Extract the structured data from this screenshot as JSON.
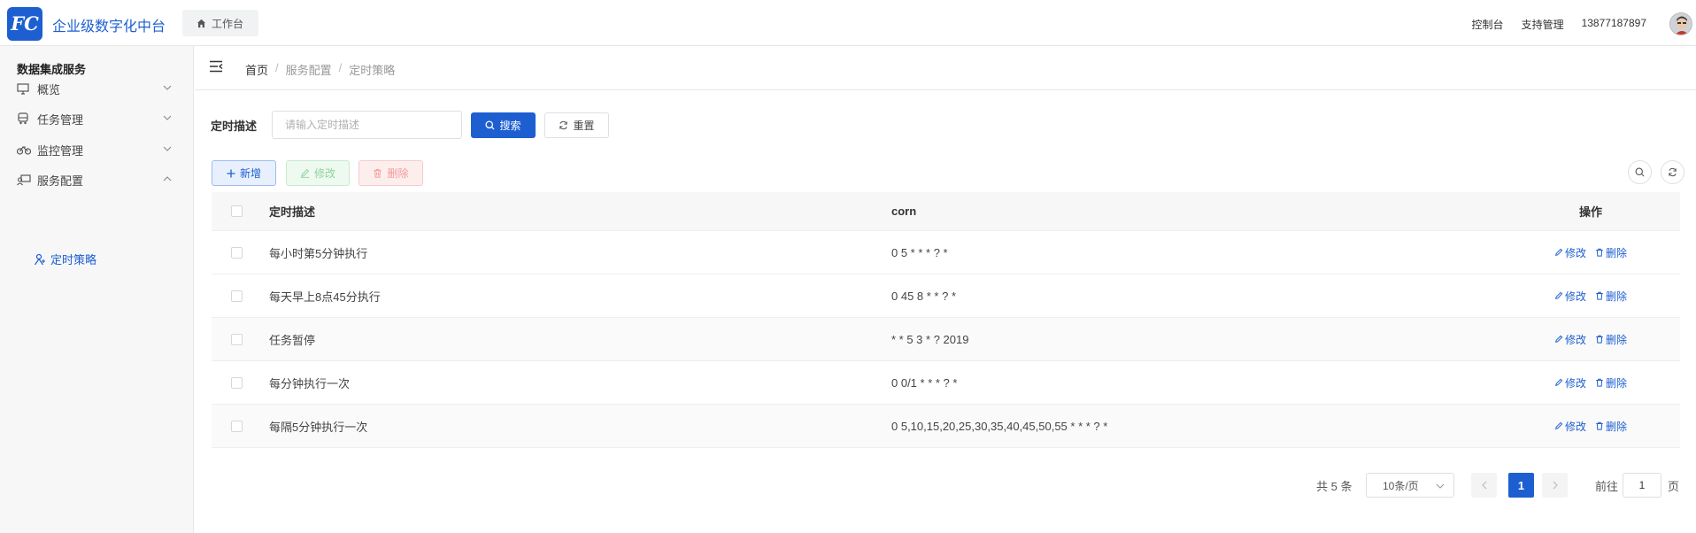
{
  "header": {
    "logo_text": "FC",
    "app_title": "企业级数字化中台",
    "home_tab": "工作台",
    "links": [
      "控制台",
      "支持管理",
      "13877187897"
    ]
  },
  "sidebar": {
    "title": "数据集成服务",
    "items": [
      {
        "label": "概览",
        "icon": "monitor-icon",
        "expanded": false
      },
      {
        "label": "任务管理",
        "icon": "bus-icon",
        "expanded": false
      },
      {
        "label": "监控管理",
        "icon": "bike-icon",
        "expanded": false
      },
      {
        "label": "服务配置",
        "icon": "service-config-icon",
        "expanded": true
      }
    ],
    "subitem": {
      "label": "定时策略",
      "icon": "strategy-icon",
      "active": true
    }
  },
  "breadcrumb": [
    "首页",
    "服务配置",
    "定时策略"
  ],
  "search": {
    "label": "定时描述",
    "placeholder": "请输入定时描述",
    "value": "",
    "search_button": "搜索",
    "reset_button": "重置"
  },
  "toolbar": {
    "add_label": "新增",
    "edit_label": "修改",
    "delete_label": "删除"
  },
  "table": {
    "columns": [
      "定时描述",
      "corn",
      "操作"
    ],
    "rows": [
      {
        "desc": "每小时第5分钟执行",
        "corn": "0 5 * * * ? *"
      },
      {
        "desc": "每天早上8点45分执行",
        "corn": "0 45 8 * * ? *"
      },
      {
        "desc": "任务暂停",
        "corn": "* * 5 3 * ? 2019"
      },
      {
        "desc": "每分钟执行一次",
        "corn": "0 0/1 * * * ? *"
      },
      {
        "desc": "每隔5分钟执行一次",
        "corn": "0 5,10,15,20,25,30,35,40,45,50,55 * * * ? *"
      }
    ],
    "row_edit": "修改",
    "row_delete": "删除"
  },
  "pagination": {
    "total": "共 5 条",
    "page_size": "10条/页",
    "current_page": "1",
    "goto_label": "前往",
    "goto_value": "1",
    "page_suffix": "页"
  },
  "colors": {
    "primary": "#1d5fd0",
    "success_light": "#8ed49e",
    "danger_light": "#f39a9a"
  }
}
